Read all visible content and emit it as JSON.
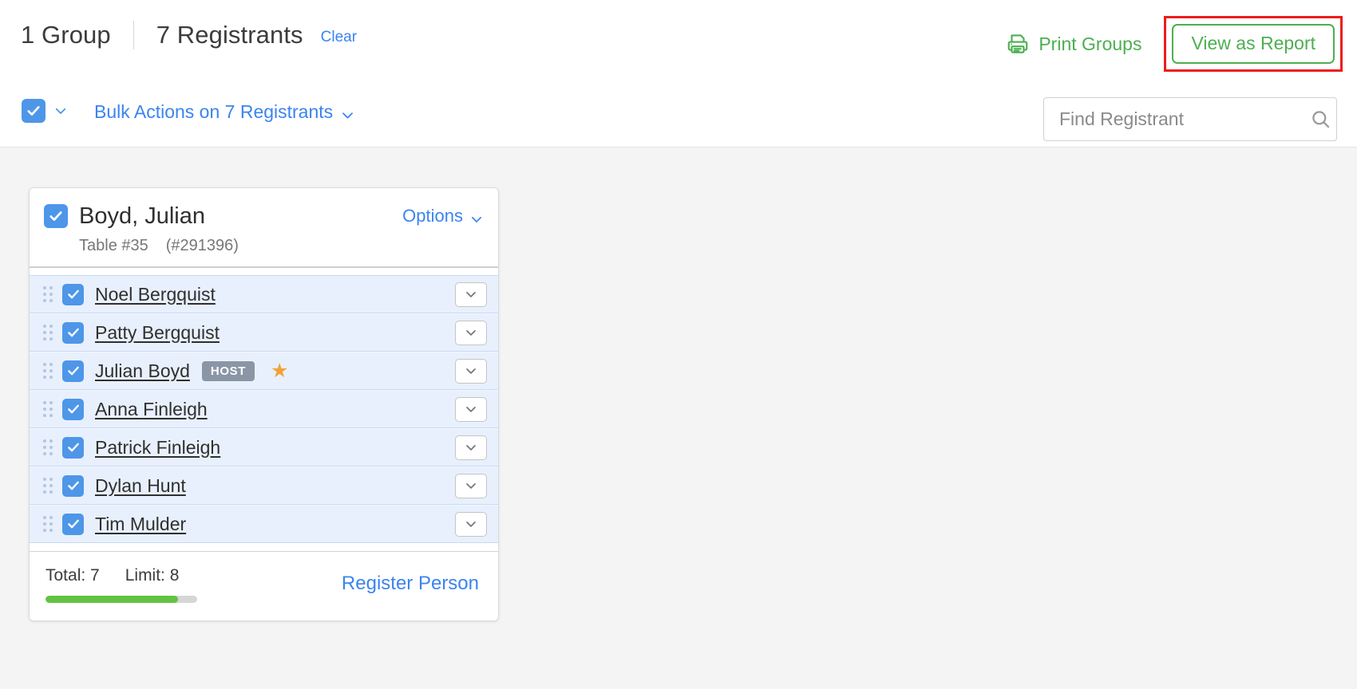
{
  "header": {
    "group_count": "1 Group",
    "registrant_count": "7 Registrants",
    "clear_label": "Clear",
    "print_groups_label": "Print Groups",
    "print_icon": "printer-icon",
    "view_report_label": "View as Report",
    "highlight_color": "#ef1b1b",
    "accent_green": "#4caf50"
  },
  "action_bar": {
    "select_all_checked": true,
    "select_all_caret_icon": "chevron-down-icon",
    "bulk_actions_label": "Bulk Actions on 7 Registrants",
    "bulk_actions_caret_icon": "chevron-down-icon",
    "accent_blue": "#3b84f0"
  },
  "search": {
    "placeholder": "Find Registrant",
    "value": "",
    "icon": "search-icon"
  },
  "group_card": {
    "checked": true,
    "title": "Boyd, Julian",
    "table_label": "Table #35",
    "group_id": "(#291396)",
    "options_label": "Options",
    "options_caret_icon": "chevron-down-icon",
    "registrants": [
      {
        "name": "Noel Bergquist",
        "checked": true,
        "badge": "",
        "starred": false
      },
      {
        "name": "Patty Bergquist",
        "checked": true,
        "badge": "",
        "starred": false
      },
      {
        "name": "Julian Boyd",
        "checked": true,
        "badge": "HOST",
        "starred": true
      },
      {
        "name": "Anna Finleigh",
        "checked": true,
        "badge": "",
        "starred": false
      },
      {
        "name": "Patrick Finleigh",
        "checked": true,
        "badge": "",
        "starred": false
      },
      {
        "name": "Dylan Hunt",
        "checked": true,
        "badge": "",
        "starred": false
      },
      {
        "name": "Tim Mulder",
        "checked": true,
        "badge": "",
        "starred": false
      }
    ],
    "footer": {
      "total_label": "Total: 7",
      "limit_label": "Limit: 8",
      "progress_percent": 87.5,
      "progress_color": "#63c341",
      "register_label": "Register Person"
    }
  }
}
